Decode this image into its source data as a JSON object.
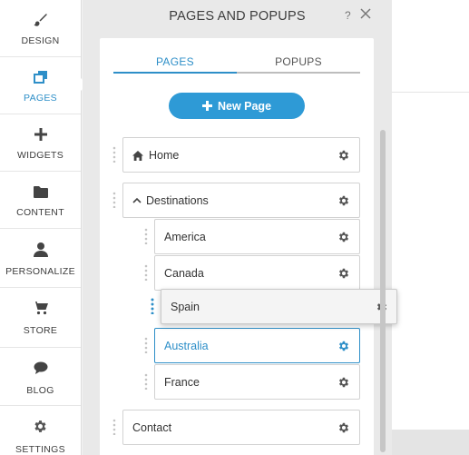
{
  "sidebar": {
    "items": [
      {
        "label": "DESIGN",
        "icon": "brush-icon"
      },
      {
        "label": "PAGES",
        "icon": "pages-icon"
      },
      {
        "label": "WIDGETS",
        "icon": "plus-icon"
      },
      {
        "label": "CONTENT",
        "icon": "folder-icon"
      },
      {
        "label": "PERSONALIZE",
        "icon": "person-icon"
      },
      {
        "label": "STORE",
        "icon": "cart-icon"
      },
      {
        "label": "BLOG",
        "icon": "speech-bubble-icon"
      },
      {
        "label": "SETTINGS",
        "icon": "gear-icon"
      }
    ],
    "active": "PAGES"
  },
  "panel": {
    "title": "PAGES AND POPUPS",
    "help": "?",
    "tabs": [
      {
        "label": "PAGES",
        "active": true
      },
      {
        "label": "POPUPS",
        "active": false
      }
    ],
    "new_page_label": "New Page",
    "pages": [
      {
        "label": "Home",
        "icon": "home-icon"
      },
      {
        "label": "Destinations",
        "icon": "chevron-up-icon",
        "expanded": true
      },
      {
        "label": "America"
      },
      {
        "label": "Canada"
      },
      {
        "label": "Spain",
        "state": "dragging"
      },
      {
        "label": "Australia",
        "state": "selected"
      },
      {
        "label": "France"
      },
      {
        "label": "Contact"
      }
    ]
  },
  "colors": {
    "accent": "#2e8fc8",
    "button": "#2e9ad6",
    "panel_bg": "#e9e9e9",
    "text": "#333333"
  }
}
